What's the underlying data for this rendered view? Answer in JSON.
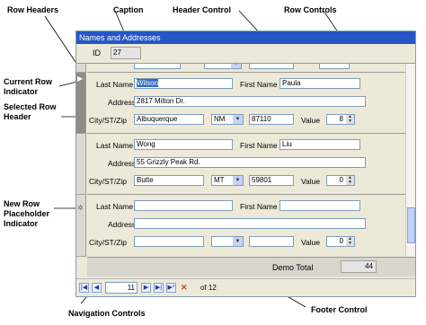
{
  "callouts": {
    "row_headers": "Row Headers",
    "caption": "Caption",
    "header_control": "Header Control",
    "row_controls": "Row Controls",
    "current_row_indicator": [
      "Current Row",
      "Indicator"
    ],
    "selected_row_header": [
      "Selected Row",
      "Header"
    ],
    "new_row_placeholder": [
      "New Row",
      "Placeholder",
      "Indicator"
    ],
    "navigation_controls": "Navigation Controls",
    "footer_control": "Footer Control"
  },
  "window": {
    "caption": "Names and Addresses",
    "header": {
      "id_label": "ID",
      "id_value": "27"
    }
  },
  "labels": {
    "last_name": "Last Name",
    "first_name": "First Name",
    "address": "Address",
    "city_st_zip": "City/ST/Zip",
    "value": "Value"
  },
  "records": [
    {
      "last_name": "Wilson",
      "first_name": "Paula",
      "address": "2817 Milton Dr.",
      "city": "Albuquerque",
      "state": "NM",
      "zip": "87110",
      "value": "8",
      "indicator": "current"
    },
    {
      "last_name": "Wong",
      "first_name": "Liu",
      "address": "55 Grizzly Peak Rd.",
      "city": "Butte",
      "state": "MT",
      "zip": "59801",
      "value": "0",
      "indicator": ""
    },
    {
      "last_name": "",
      "first_name": "",
      "address": "",
      "city": "",
      "state": "",
      "zip": "",
      "value": "0",
      "indicator": "new"
    }
  ],
  "glyphs": {
    "current": "▶",
    "new": "✲"
  },
  "footer": {
    "label": "Demo Total",
    "value": "44"
  },
  "navigator": {
    "current": "11",
    "of_text": "of 12",
    "first": "|◀",
    "prev": "◀",
    "next": "▶",
    "last": "▶|",
    "new": "▶*",
    "delete": "✕"
  },
  "colors": {
    "caption_bg": "#2456c6",
    "window_bg": "#ece9d8",
    "selected_header": "#8e8c84",
    "selection_highlight": "#316ac5"
  }
}
